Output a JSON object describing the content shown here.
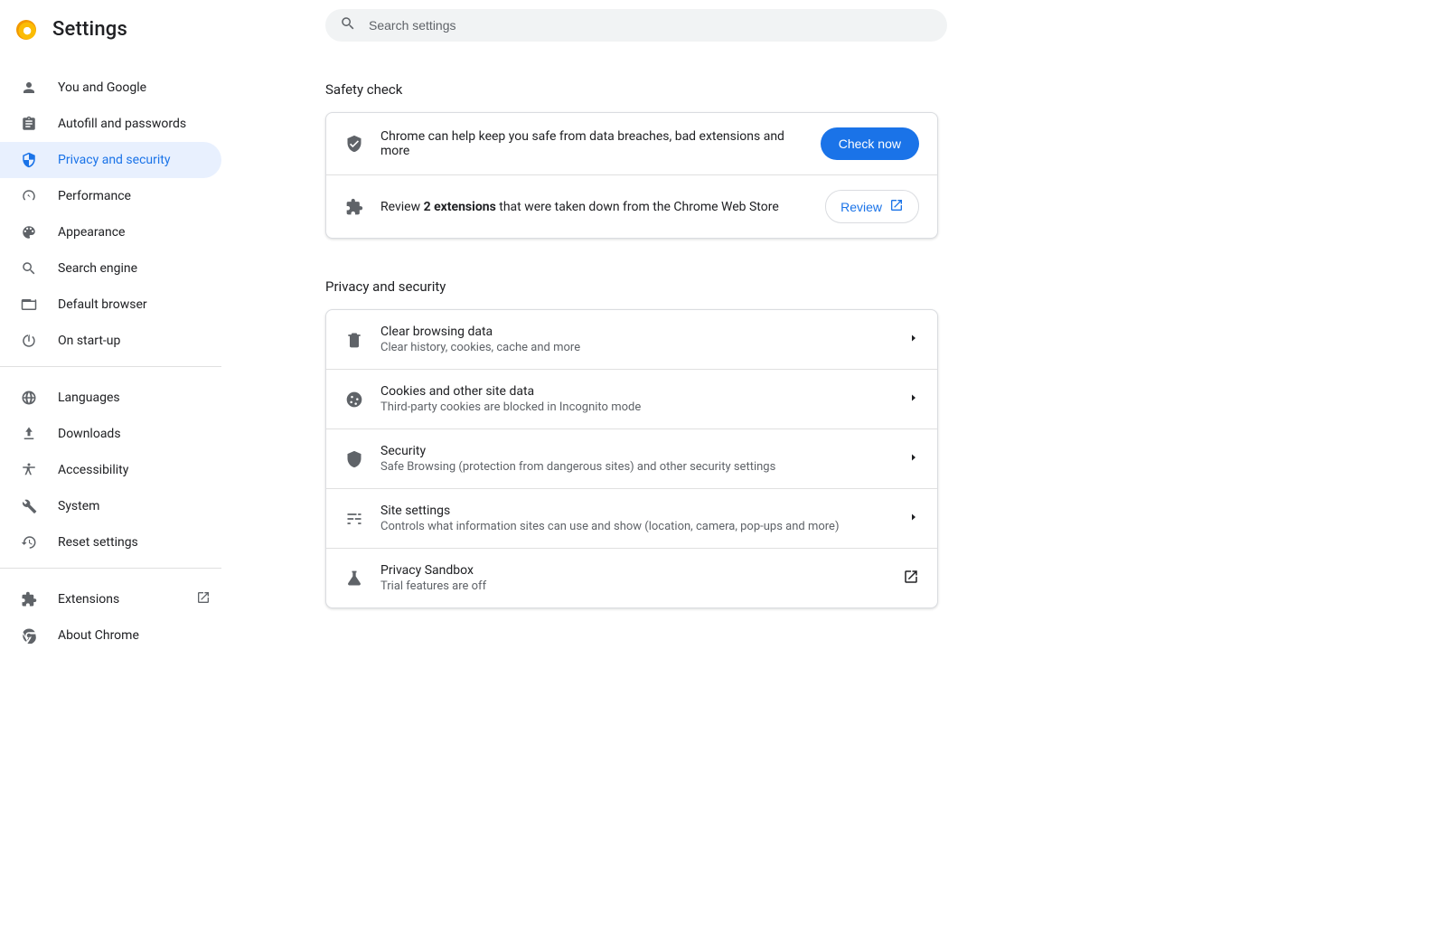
{
  "app_title": "Settings",
  "search": {
    "placeholder": "Search settings"
  },
  "sidebar": {
    "group1": {
      "you": "You and Google",
      "autofill": "Autofill and passwords",
      "privacy": "Privacy and security",
      "performance": "Performance",
      "appearance": "Appearance",
      "search": "Search engine",
      "default_browser": "Default browser",
      "startup": "On start-up"
    },
    "group2": {
      "languages": "Languages",
      "downloads": "Downloads",
      "accessibility": "Accessibility",
      "system": "System",
      "reset": "Reset settings"
    },
    "group3": {
      "extensions": "Extensions",
      "about": "About Chrome"
    }
  },
  "sections": {
    "safety_title": "Safety check",
    "safety_row1": {
      "text": "Chrome can help keep you safe from data breaches, bad extensions and more",
      "action": "Check now"
    },
    "safety_row2": {
      "prefix": "Review ",
      "bold": "2 extensions",
      "suffix": " that were taken down from the Chrome Web Store",
      "action": "Review"
    },
    "privacy_title": "Privacy and security",
    "privacy_rows": {
      "clear": {
        "title": "Clear browsing data",
        "sub": "Clear history, cookies, cache and more"
      },
      "cookies": {
        "title": "Cookies and other site data",
        "sub": "Third-party cookies are blocked in Incognito mode"
      },
      "security": {
        "title": "Security",
        "sub": "Safe Browsing (protection from dangerous sites) and other security settings"
      },
      "site": {
        "title": "Site settings",
        "sub": "Controls what information sites can use and show (location, camera, pop-ups and more)"
      },
      "sandbox": {
        "title": "Privacy Sandbox",
        "sub": "Trial features are off"
      }
    }
  }
}
